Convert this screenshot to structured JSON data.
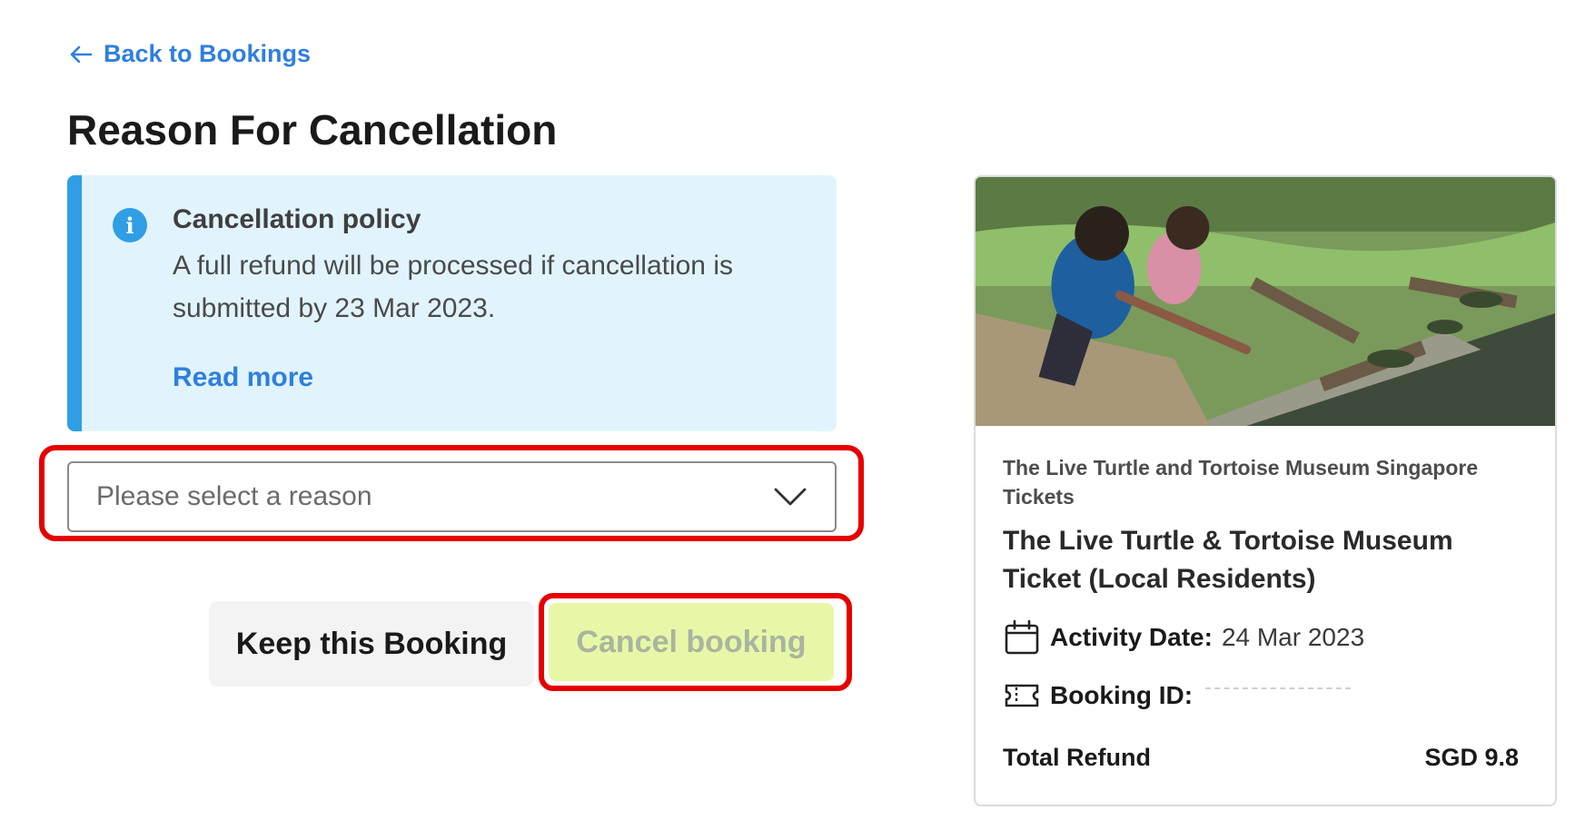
{
  "nav": {
    "back_label": "Back to Bookings"
  },
  "page": {
    "title": "Reason For Cancellation"
  },
  "policy": {
    "title": "Cancellation policy",
    "text": "A full refund will be processed if cancellation is submitted by 23 Mar 2023.",
    "read_more": "Read more"
  },
  "reason_select": {
    "placeholder": "Please select a reason"
  },
  "actions": {
    "keep_label": "Keep this Booking",
    "cancel_label": "Cancel booking"
  },
  "booking_card": {
    "category": "The Live Turtle and Tortoise Museum Singapore Tickets",
    "title": "The Live Turtle & Tortoise Museum Ticket (Local Residents)",
    "activity_date_label": "Activity Date:",
    "activity_date_value": "24 Mar 2023",
    "booking_id_label": "Booking ID:",
    "total_label": "Total Refund",
    "total_value": "SGD 9.8"
  },
  "colors": {
    "link": "#2f7fe0",
    "policy_bg": "#e1f4fd",
    "policy_accent": "#2f9ee5",
    "cancel_bg": "#e8f7a7",
    "highlight": "#e60000"
  },
  "icons": [
    "arrow-left-icon",
    "info-icon",
    "chevron-down-icon",
    "calendar-icon",
    "ticket-icon"
  ]
}
